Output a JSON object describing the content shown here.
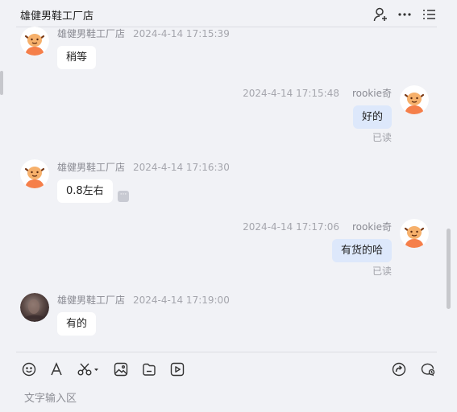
{
  "header": {
    "title": "雄健男鞋工厂店",
    "icons": [
      "add-user-icon",
      "more-icon",
      "menu-list-icon"
    ]
  },
  "messages": [
    {
      "sender": "雄健男鞋工厂店",
      "time": "2024-4-14 17:15:39",
      "text": "稍等",
      "direction": "in"
    },
    {
      "sender": "rookie奇",
      "time": "2024-4-14 17:15:48",
      "text": "好的",
      "direction": "out",
      "status": "已读"
    },
    {
      "sender": "雄健男鞋工厂店",
      "time": "2024-4-14 17:16:30",
      "text": "0.8左右",
      "direction": "in"
    },
    {
      "sender": "rookie奇",
      "time": "2024-4-14 17:17:06",
      "text": "有货的哈",
      "direction": "out",
      "status": "已读"
    },
    {
      "sender": "雄健男鞋工厂店",
      "time": "2024-4-14 17:19:00",
      "text": "有的",
      "direction": "in"
    }
  ],
  "more_glyph": "···",
  "toolbar": {
    "icons": [
      "emoji-icon",
      "font-icon",
      "scissors-icon",
      "image-icon",
      "file-icon",
      "video-icon",
      "forward-icon",
      "chat-history-icon"
    ]
  },
  "composer": {
    "placeholder": "文字输入区"
  },
  "colors": {
    "background": "#f1f2f6",
    "bubble_in": "#ffffff",
    "bubble_out": "#dde8fb",
    "avatar_orange": "#f57f4a"
  }
}
